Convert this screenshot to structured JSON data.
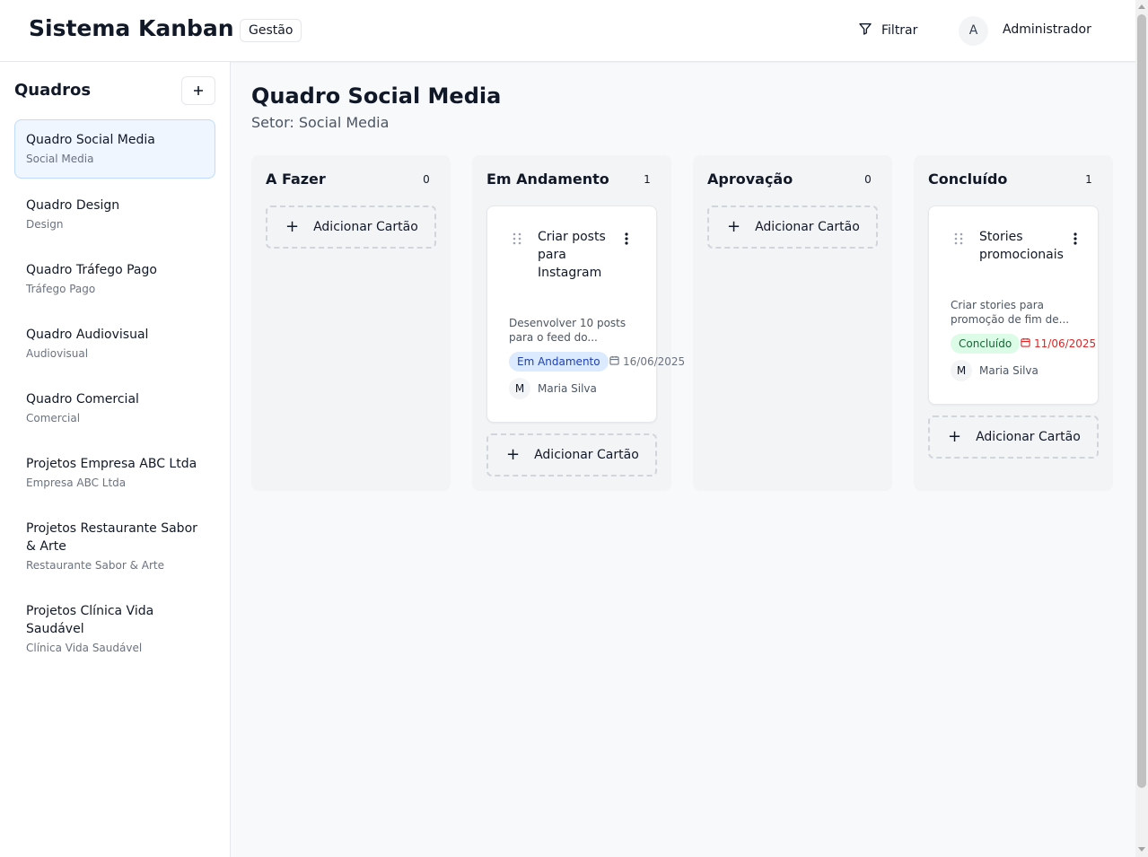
{
  "header": {
    "app_title": "Sistema Kanban",
    "badge": "Gestão",
    "filter_label": "Filtrar",
    "user_initial": "A",
    "user_name": "Administrador"
  },
  "sidebar": {
    "title": "Quadros",
    "add_icon": "plus-icon",
    "boards": [
      {
        "name": "Quadro Social Media",
        "sector": "Social Media",
        "active": true
      },
      {
        "name": "Quadro Design",
        "sector": "Design"
      },
      {
        "name": "Quadro Tráfego Pago",
        "sector": "Tráfego Pago"
      },
      {
        "name": "Quadro Audiovisual",
        "sector": "Audiovisual"
      },
      {
        "name": "Quadro Comercial",
        "sector": "Comercial"
      },
      {
        "name": "Projetos Empresa ABC Ltda",
        "sector": "Empresa ABC Ltda"
      },
      {
        "name": "Projetos Restaurante Sabor & Arte",
        "sector": "Restaurante Sabor & Arte"
      },
      {
        "name": "Projetos Clínica Vida Saudável",
        "sector": "Clínica Vida Saudável"
      }
    ]
  },
  "main": {
    "title": "Quadro Social Media",
    "subtitle": "Setor: Social Media",
    "add_card_label": "Adicionar Cartão",
    "columns": [
      {
        "title": "A Fazer",
        "count": "0",
        "cards": []
      },
      {
        "title": "Em Andamento",
        "count": "1",
        "cards": [
          {
            "title": "Criar posts para Instagram",
            "description": "Desenvolver 10 posts para o feed do...",
            "status": "Em Andamento",
            "due": "16/06/2025",
            "assignee_initial": "M",
            "assignee": "Maria Silva"
          }
        ]
      },
      {
        "title": "Aprovação",
        "count": "0",
        "cards": []
      },
      {
        "title": "Concluído",
        "count": "1",
        "cards": [
          {
            "title": "Stories promocionais",
            "description": "Criar stories para promoção de fim de...",
            "status": "Concluído",
            "due": "11/06/2025",
            "assignee_initial": "M",
            "assignee": "Maria Silva"
          }
        ]
      }
    ]
  },
  "colors": {
    "accent_blue": "#1e40af",
    "accent_green": "#166534",
    "overdue_red": "#dc2626"
  }
}
